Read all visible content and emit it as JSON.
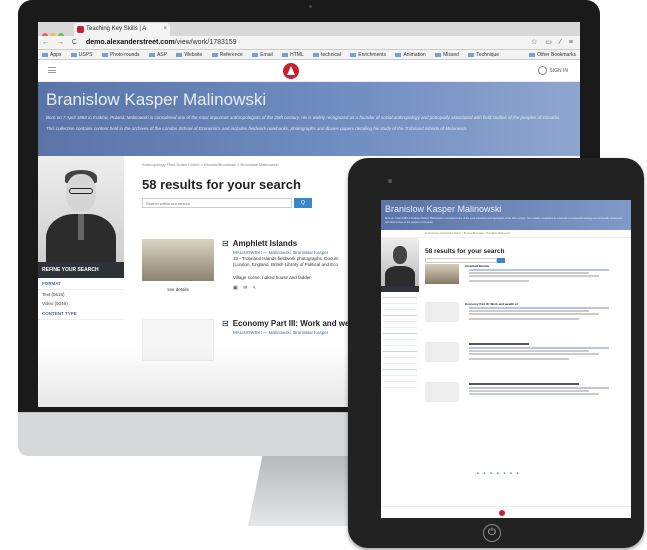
{
  "browser": {
    "tab_title": "Teaching Key Skills | A",
    "tab_close": "×",
    "nav_buttons": "← → C",
    "url_host": "demo.alexanderstreet.com",
    "url_path": "/view/work/1783159",
    "toolbar_icons": "☆ ▭ ⁄ ≡",
    "bookmarks": [
      "Apps",
      "USPS",
      "Photo rounds",
      "ASP",
      "Website",
      "Reference",
      "Email",
      "HTML",
      "technical",
      "Enrichments",
      "Animation",
      "Missed",
      "Technique"
    ],
    "other_bookmarks": "Other Bookmarks"
  },
  "site": {
    "signin_label": "SIGN IN",
    "hero_title": "Branislow Kasper Malinowski",
    "hero_para1": "Born on 7 April 1884 in Kraków, Poland, Malinowski is considered one of the most important anthropologists of the 20th century. He is widely recognized as a founder of social anthropology and principally associated with field studies of the peoples of Oceania.",
    "hero_para2": "This collection contains content held in the archives of the London School of Economics and includes fieldwork notebooks, photographs and diaries papers detailing his study of the Trobriand Islands of Melanesia."
  },
  "sidebar": {
    "refine_label": "REFINE YOUR SEARCH",
    "facet1_label": "FORMAT",
    "facet1_items": [
      "Text (5615)",
      "Video (5046)"
    ],
    "facet2_label": "CONTENT TYPE"
  },
  "main": {
    "breadcrumb": "Anthropology Field Notes Online > Browse/Bronisław > Bronisław Malinowski",
    "results_title": "58 results for your search",
    "search_placeholder": "Search within our search",
    "search_button": "Q"
  },
  "results": [
    {
      "title": "Amphlett Islands",
      "check": "⊟",
      "meta1": "MALINOWSKI — Malinowski, Bronislaw Kasper",
      "meta2": "13 - Trobriand Islands fieldwork photographs. Docum",
      "meta3": "(London, England. British Library of Political and Eco",
      "description": "Village scene: naked house and fadder",
      "icons": "▣ ✉ <",
      "see_details": "see details"
    },
    {
      "title": "Economy Part III: Work and wealth of",
      "check": "⊟",
      "meta1": "MALINOWSKI — Malinowski, Bronislaw Kasper"
    }
  ],
  "tablet": {
    "hero_title": "Branislow Kasper Malinowski",
    "results_title": "58 results for your search",
    "home_glyph": "⏻"
  }
}
